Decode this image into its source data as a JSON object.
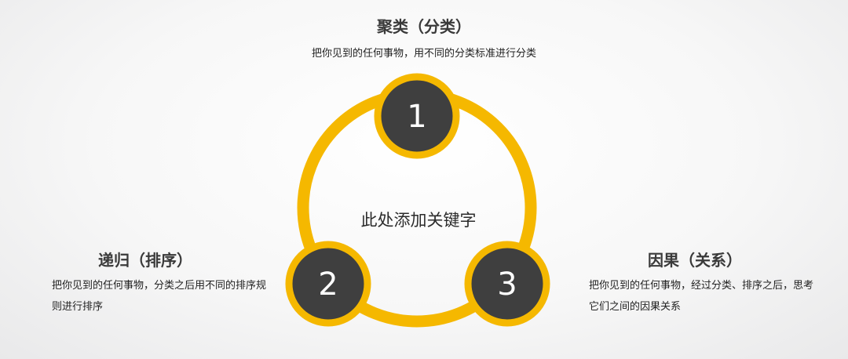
{
  "center_keyword": "此处添加关键字",
  "nodes": [
    {
      "number": "1",
      "title": "聚类（分类）",
      "description": "把你见到的任何事物，用不同的分类标准进行分类"
    },
    {
      "number": "2",
      "title": "递归（排序）",
      "description": "把你见到的任何事物，分类之后用不同的排序规则进行排序"
    },
    {
      "number": "3",
      "title": "因果（关系）",
      "description": "把你见到的任何事物，经过分类、排序之后，思考它们之间的因果关系"
    }
  ],
  "colors": {
    "ring": "#f5b800",
    "node_fill": "#3f3f3f",
    "node_border": "#f5b800",
    "number_text": "#ffffff"
  }
}
